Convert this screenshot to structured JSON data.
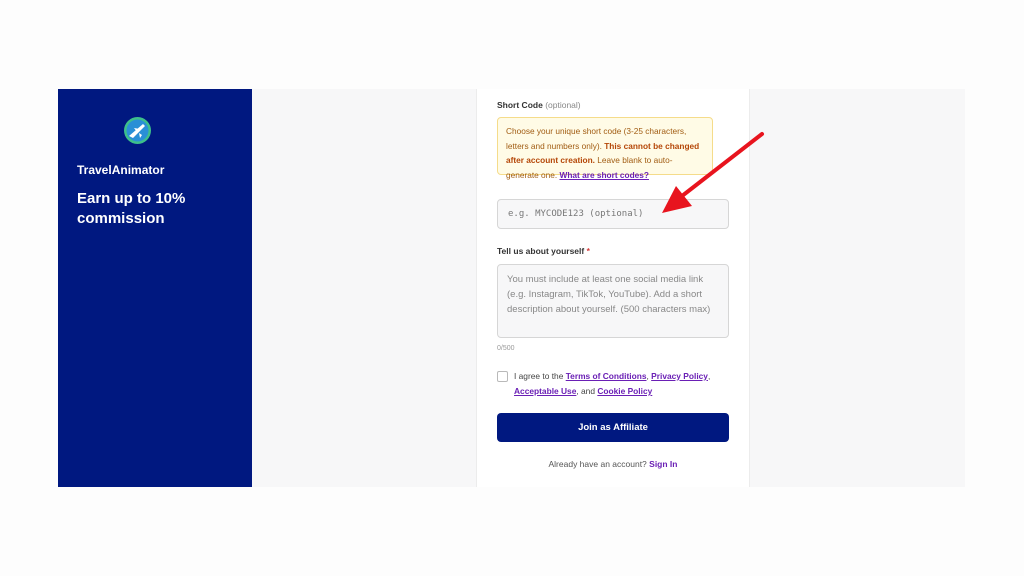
{
  "sidebar": {
    "brand": "TravelAnimator",
    "headline": "Earn up to 10% commission",
    "logo_icon": "plane-globe-icon"
  },
  "short_code": {
    "label": "Short Code",
    "optional_tag": "(optional)",
    "notice_text": "Choose your unique short code (3-25 characters, letters and numbers only). ",
    "notice_bold": "This cannot be changed after account creation.",
    "notice_tail": " Leave blank to auto-generate one. ",
    "notice_link": "What are short codes?",
    "placeholder": "e.g. MYCODE123 (optional)"
  },
  "about": {
    "label": "Tell us about yourself",
    "required_mark": "*",
    "placeholder": "You must include at least one social media link (e.g. Instagram, TikTok, YouTube). Add a short description about yourself. (500 characters max)",
    "counter": "0/500"
  },
  "agree": {
    "prefix": "I agree to the ",
    "terms": "Terms of Conditions",
    "sep1": ", ",
    "privacy": "Privacy Policy",
    "sep2": ", ",
    "acceptable": "Acceptable Use",
    "sep3": ", and ",
    "cookie": "Cookie Policy"
  },
  "join_button": "Join as Affiliate",
  "signin": {
    "prompt": "Already have an account? ",
    "link": "Sign In"
  },
  "colors": {
    "brand_navy": "#001880",
    "link_purple": "#6a1fb5",
    "annotation_red": "#e8141e"
  }
}
